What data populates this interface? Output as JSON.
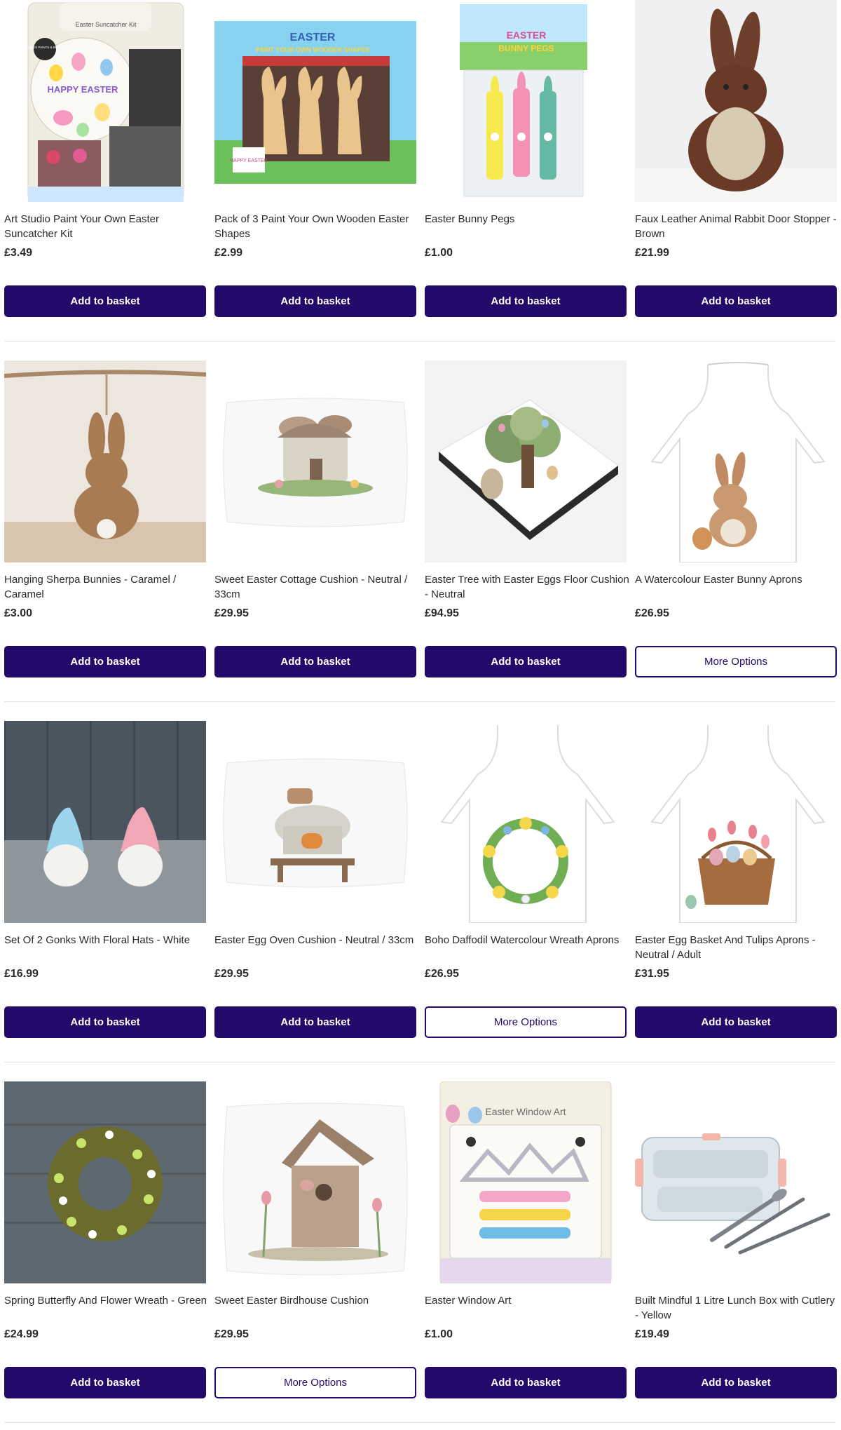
{
  "products": [
    {
      "title": "Art Studio Paint Your Own Easter Suncatcher Kit",
      "price": "£3.49",
      "button": "Add to basket",
      "style": "primary",
      "image": "suncatcher-kit"
    },
    {
      "title": "Pack of 3 Paint Your Own Wooden Easter Shapes",
      "price": "£2.99",
      "button": "Add to basket",
      "style": "primary",
      "image": "wooden-shapes"
    },
    {
      "title": "Easter Bunny Pegs",
      "price": "£1.00",
      "button": "Add to basket",
      "style": "primary",
      "image": "bunny-pegs"
    },
    {
      "title": "Faux Leather Animal Rabbit Door Stopper - Brown",
      "price": "£21.99",
      "button": "Add to basket",
      "style": "primary",
      "image": "rabbit-door-stopper"
    },
    {
      "title": "Hanging Sherpa Bunnies - Caramel / Caramel",
      "price": "£3.00",
      "button": "Add to basket",
      "style": "primary",
      "image": "sherpa-bunny"
    },
    {
      "title": "Sweet Easter Cottage Cushion - Neutral / 33cm",
      "price": "£29.95",
      "button": "Add to basket",
      "style": "primary",
      "image": "cottage-cushion"
    },
    {
      "title": "Easter Tree with Easter Eggs Floor Cushion - Neutral",
      "price": "£94.95",
      "button": "Add to basket",
      "style": "primary",
      "image": "tree-floor-cushion"
    },
    {
      "title": "A Watercolour Easter Bunny Aprons",
      "price": "£26.95",
      "button": "More Options",
      "style": "outline",
      "image": "bunny-apron"
    },
    {
      "title": "Set Of 2 Gonks With Floral Hats - White",
      "price": "£16.99",
      "button": "Add to basket",
      "style": "primary",
      "image": "gonks"
    },
    {
      "title": "Easter Egg Oven Cushion - Neutral / 33cm",
      "price": "£29.95",
      "button": "Add to basket",
      "style": "primary",
      "image": "oven-cushion"
    },
    {
      "title": "Boho Daffodil Watercolour Wreath Aprons",
      "price": "£26.95",
      "button": "More Options",
      "style": "outline",
      "image": "daffodil-apron"
    },
    {
      "title": "Easter Egg Basket And Tulips Aprons - Neutral / Adult",
      "price": "£31.95",
      "button": "Add to basket",
      "style": "primary",
      "image": "basket-apron"
    },
    {
      "title": "Spring Butterfly And Flower Wreath - Green",
      "price": "£24.99",
      "button": "Add to basket",
      "style": "primary",
      "image": "flower-wreath"
    },
    {
      "title": "Sweet Easter Birdhouse Cushion",
      "price": "£29.95",
      "button": "More Options",
      "style": "outline",
      "image": "birdhouse-cushion"
    },
    {
      "title": "Easter Window Art",
      "price": "£1.00",
      "button": "Add to basket",
      "style": "primary",
      "image": "window-art"
    },
    {
      "title": "Built Mindful 1 Litre Lunch Box with Cutlery - Yellow",
      "price": "£19.49",
      "button": "Add to basket",
      "style": "primary",
      "image": "lunch-box"
    }
  ],
  "image_text": {
    "suncatcher_box": "Easter Suncatcher Kit",
    "suncatcher_badge": "INCLUDES PAINTS & BRUSHES",
    "suncatcher_center": "HAPPY EASTER",
    "wooden_header_1": "EASTER",
    "wooden_header_2": "PAINT YOUR OWN WOODEN SHAPES",
    "wooden_sticker": "HAPPY EASTER",
    "pegs_header_1": "EASTER",
    "pegs_header_2": "BUNNY PEGS",
    "window_art_title": "Easter Window Art"
  },
  "colors": {
    "brand_purple": "#23096a",
    "divider": "#e2e2e2",
    "text": "#2a2a2a"
  }
}
